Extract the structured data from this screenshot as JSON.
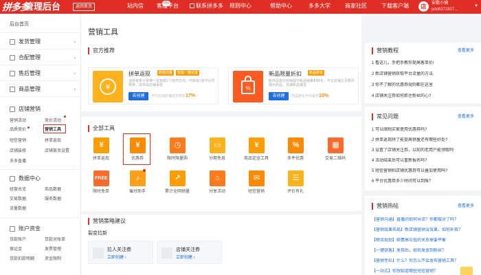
{
  "header": {
    "logo": "拼多多",
    "logo_sub": "管理后台",
    "back_home": "返回首页",
    "nav": [
      "站内信",
      "客服平台",
      "联系拼多多",
      "规则中心",
      "帮助中心",
      "多多大学",
      "商家社区",
      "下载客户端"
    ],
    "badge": "99+",
    "user": {
      "avatar": "店",
      "name": "安歌小铺",
      "id": "pdd6372807..."
    }
  },
  "sidebar": {
    "home": "后台首页",
    "groups": [
      "发货管理",
      "合配管理",
      "售后管理",
      "商品管理",
      "店铺营销"
    ],
    "marketing_items": [
      "营销活动",
      "竞价活动",
      "品质竞价",
      "营销工具",
      "短信营销",
      "拼单返现",
      "店铺装修",
      "店铺首页设置",
      "多多直播"
    ],
    "data_center": "数据中心",
    "data_items": [
      "经营总览",
      "商品数据",
      "交易数据",
      "服务数据",
      "流量数据"
    ],
    "account": "账户资金",
    "account_items": [
      "货款账户",
      "货款对账单",
      "保证金",
      "发票管理",
      "货款扣款明细",
      "资金限制"
    ]
  },
  "main": {
    "page_title": "营销工具",
    "official": {
      "title": "官方推荐",
      "promos": [
        {
          "title": "拼单返现",
          "tags": [
            "刚需流量",
            "智能一键设置"
          ],
          "desc": "消费者累计拼满一定金额1个自然日内，可获得1张平台优惠券，成本由店铺承担",
          "btn": "去创建",
          "note": "平均拉动店铺成交增长",
          "pct": "17%"
        },
        {
          "title": "新品限量折扣",
          "tags": [
            "新品转化"
          ],
          "desc": "新商品低价促销提升新品销量和转化，可在店铺主页额外展示商品，加速新品爆发",
          "btn": "去创建",
          "note": "商品转化平均提升",
          "pct": "10%"
        }
      ]
    },
    "all_tools": {
      "title": "全部工具",
      "row1": [
        "拼单返现",
        "优惠券",
        "限时限量购",
        "分期免息",
        "商品定金工具",
        "多件优惠",
        "交易二维码"
      ],
      "row2": [
        "限时免单",
        "催付助手",
        "累计全网销量",
        "分享活动",
        "短信营销",
        "评价有礼"
      ]
    },
    "strategy": {
      "title": "营销策略建议",
      "sub": "裂变拉新",
      "items": [
        {
          "name": "拉人关注券",
          "link": "立即创建 ›"
        },
        {
          "name": "店铺关注券",
          "link": "立即创建 ›"
        }
      ]
    }
  },
  "right": {
    "tutorial": {
      "title": "营销教程",
      "more": "查看更多",
      "items": [
        "1 看这儿，手把手教你提高客单价!",
        "2 新店铺营销获取平台流量的方法",
        "3 你不了解的优惠券规则都在这里",
        "4 店铺关注券如何抓住粉丝的心?"
      ]
    },
    "faq": {
      "title": "常见问题",
      "more": "查看更多",
      "items": [
        "1 可以限制买家使用优惠券吗?",
        "2 拼单返现除了能提高销量还有哪些好处?",
        "3 设置了店铺关注券，以前的老用户能领取吗?",
        "4 活动结束后可以重新报名吗?",
        "5 短信营销和店铺优惠券可以叠加使用吗?",
        "6 平台优惠券多少时间可以到账?"
      ]
    },
    "hot": {
      "title": "营销热帖",
      "more": "查看更多",
      "items": [
        "【营销沟通】直播间如何导流？你都做对了吗？",
        "【营销效果布局】新店铺营销没效果，如何补救？",
        "【物流规划】邮费高与低的关系需要平衡",
        "【一键获客】发券后，如何发放到粉丝？",
        "【营销专栏】什么？你怎么不会发布营销工具？",
        "【一站式】你想知道哪些短信营销？",
        "【营销实践】拼单返现的活动技巧"
      ]
    }
  },
  "colors": {
    "brand": "#e02e24",
    "accent": "#ff8a00",
    "link": "#1e6fe0"
  }
}
